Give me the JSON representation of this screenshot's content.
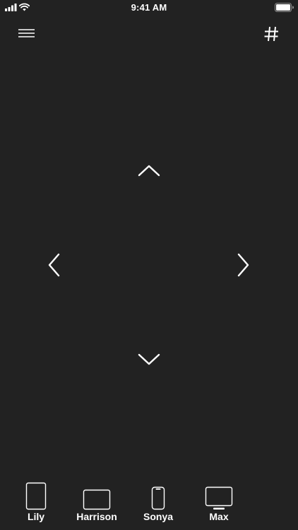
{
  "status_bar": {
    "time": "9:41 AM"
  },
  "header": {
    "menu_icon": "hamburger-icon",
    "grid_icon": "hash-icon"
  },
  "dpad": {
    "up_icon": "chevron-up-icon",
    "down_icon": "chevron-down-icon",
    "left_icon": "chevron-left-icon",
    "right_icon": "chevron-right-icon"
  },
  "devices": [
    {
      "label": "Lily",
      "icon": "tablet-portrait-icon"
    },
    {
      "label": "Harrison",
      "icon": "tablet-landscape-icon"
    },
    {
      "label": "Sonya",
      "icon": "phone-icon"
    },
    {
      "label": "Max",
      "icon": "tv-icon"
    }
  ],
  "colors": {
    "background": "#222222",
    "foreground": "#ffffff"
  }
}
